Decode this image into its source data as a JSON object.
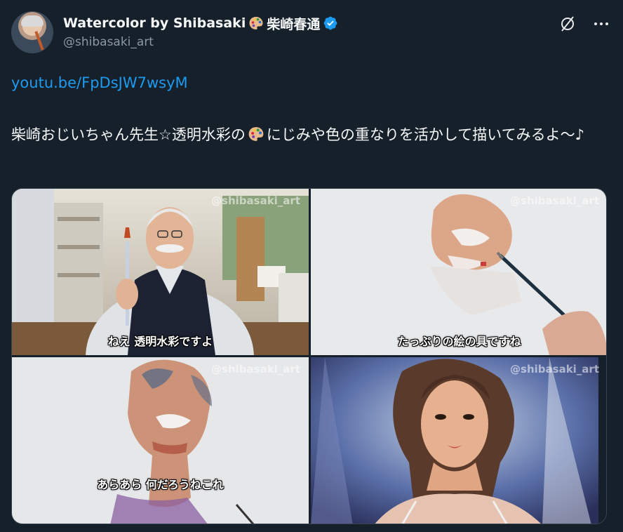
{
  "author": {
    "display_name": "Watercolor by Shibasaki",
    "display_name_suffix": "柴崎春通",
    "handle": "@shibasaki_art",
    "verified": true
  },
  "header_icons": [
    "grok-icon",
    "more-icon"
  ],
  "tweet": {
    "link_text": "youtu.be/FpDsJW7wsyM",
    "text_part1": "柴崎おじいちゃん先生☆透明水彩の",
    "text_part2": "にじみや色の重なりを活かして描いてみるよ〜♪"
  },
  "media": [
    {
      "watermark": "@shibasaki_art",
      "subtitle": "ねえ 透明水彩ですよ"
    },
    {
      "watermark": "@shibasaki_art",
      "subtitle": "たっぷりの絵の具ですね"
    },
    {
      "watermark": "@shibasaki_art",
      "subtitle": "あらあら 何だろうねこれ"
    },
    {
      "watermark": "@shibasaki_art",
      "subtitle": ""
    }
  ],
  "colors": {
    "background": "#15202b",
    "text": "#f7f9f9",
    "secondary": "#8b98a5",
    "link": "#1d9bf0",
    "verified": "#1d9bf0"
  }
}
